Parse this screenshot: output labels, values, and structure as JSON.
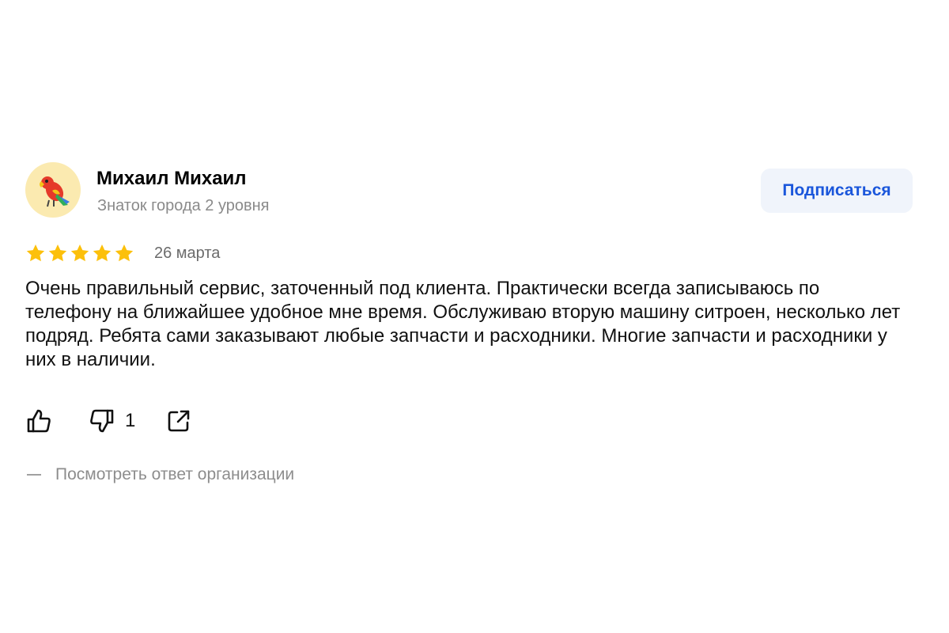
{
  "author": {
    "name": "Михаил Михаил",
    "level": "Знаток города 2 уровня",
    "avatar_icon": "parrot-icon"
  },
  "subscribe_label": "Подписаться",
  "rating": {
    "value": 5,
    "max": 5,
    "star_color": "#fcc00b"
  },
  "date": "26 марта",
  "review_text": "Очень правильный сервис, заточенный под клиента. Практически всегда записываюсь по телефону на ближайшее удобное мне время. Обслуживаю вторую машину ситроен, несколько лет подряд. Ребята сами заказывают любые запчасти и расходники. Многие запчасти и расходники у них в наличии.",
  "actions": {
    "like_icon": "thumbs-up-icon",
    "dislike_icon": "thumbs-down-icon",
    "dislike_count": "1",
    "share_icon": "share-icon"
  },
  "org_answer_link": "Посмотреть ответ организации",
  "colors": {
    "accent": "#1a56db",
    "button_bg": "#f0f4fb",
    "muted": "#8a8a8a"
  }
}
